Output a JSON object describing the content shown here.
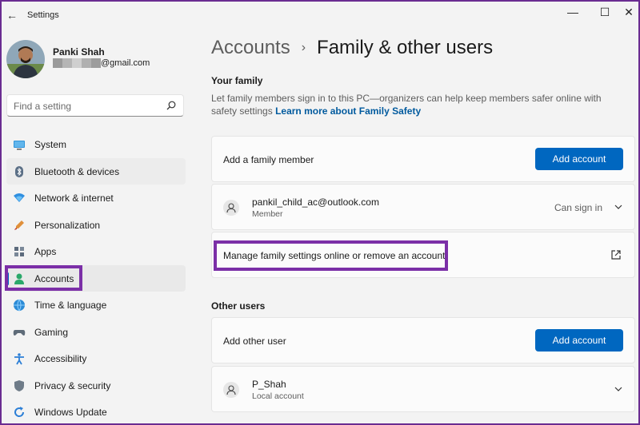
{
  "window": {
    "title": "Settings",
    "back_glyph": "←",
    "minimize_glyph": "—",
    "maximize_glyph": "☐",
    "close_glyph": "✕"
  },
  "profile": {
    "name": "Panki Shah",
    "email_suffix": "@gmail.com"
  },
  "search": {
    "placeholder": "Find a setting"
  },
  "sidebar": {
    "items": [
      {
        "label": "System",
        "icon": "system-icon"
      },
      {
        "label": "Bluetooth & devices",
        "icon": "bluetooth-icon"
      },
      {
        "label": "Network & internet",
        "icon": "network-icon"
      },
      {
        "label": "Personalization",
        "icon": "personalization-icon"
      },
      {
        "label": "Apps",
        "icon": "apps-icon"
      },
      {
        "label": "Accounts",
        "icon": "accounts-icon"
      },
      {
        "label": "Time & language",
        "icon": "time-language-icon"
      },
      {
        "label": "Gaming",
        "icon": "gaming-icon"
      },
      {
        "label": "Accessibility",
        "icon": "accessibility-icon"
      },
      {
        "label": "Privacy & security",
        "icon": "privacy-shield-icon"
      },
      {
        "label": "Windows Update",
        "icon": "windows-update-icon"
      }
    ],
    "selected": "Accounts"
  },
  "breadcrumb": {
    "parent": "Accounts",
    "separator": "›",
    "current": "Family & other users"
  },
  "family": {
    "section_title": "Your family",
    "description": "Let family members sign in to this PC—organizers can help keep members safer online with safety settings",
    "learn_more": "Learn more about Family Safety",
    "add_member_label": "Add a family member",
    "add_account_label": "Add account",
    "member": {
      "email": "pankil_child_ac@outlook.com",
      "role": "Member",
      "status": "Can sign in"
    },
    "manage_label": "Manage family settings online or remove an account"
  },
  "other_users": {
    "section_title": "Other users",
    "add_label": "Add other user",
    "add_account_label": "Add account",
    "user": {
      "name": "P_Shah",
      "type": "Local account"
    }
  },
  "colors": {
    "accent": "#0067c0",
    "highlight": "#7b2fa7",
    "background": "#f3f3f3"
  }
}
